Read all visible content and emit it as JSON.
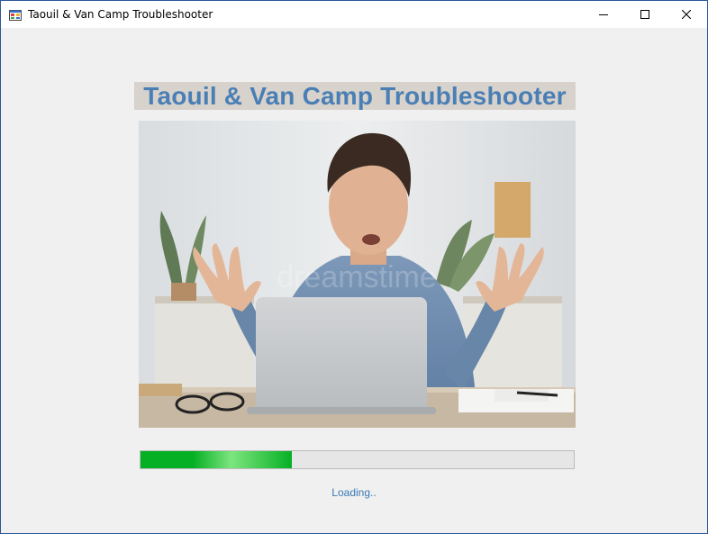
{
  "window": {
    "title": "Taouil & Van Camp Troubleshooter",
    "icon": "windows-forms-app-icon",
    "controls": [
      "minimize-icon",
      "maximize-icon",
      "close-icon"
    ]
  },
  "main": {
    "heading": "Taouil & Van Camp Troubleshooter",
    "image": {
      "subject": "frustrated man at laptop",
      "watermark": "dreamstime"
    },
    "progress": {
      "value": 0.35
    },
    "status": "Loading.."
  },
  "colors": {
    "heading_text": "#4a7fb5",
    "heading_background": "#d8d2cc",
    "progress_fill": "#06b025",
    "status_text": "#3a79b5"
  }
}
